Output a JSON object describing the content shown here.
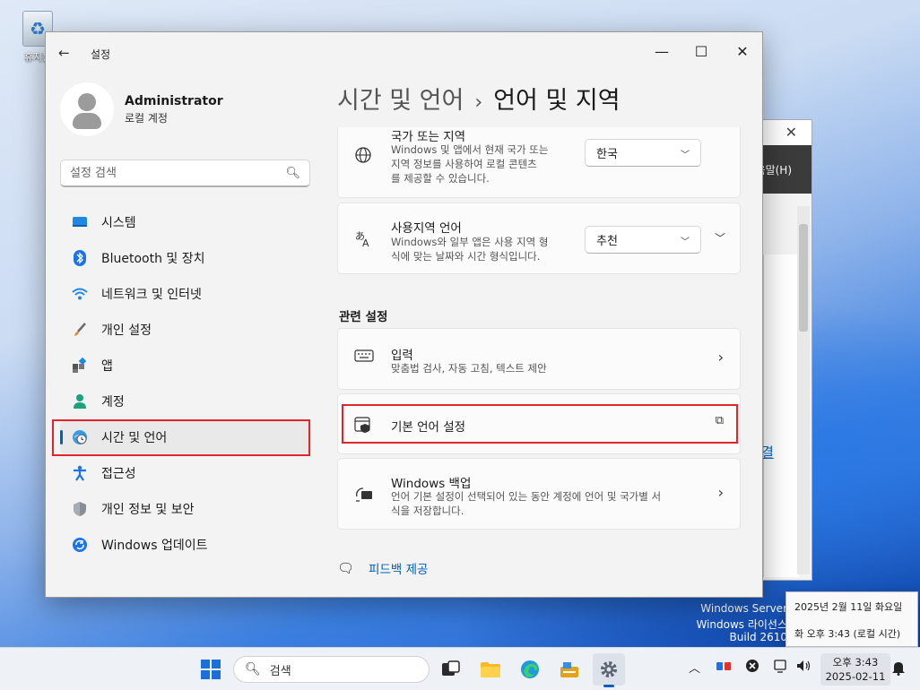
{
  "desktop": {
    "recycle_bin_label": "휴지통",
    "watermark": [
      "Windows Server",
      "Windows 라이선스",
      "Build 2610"
    ]
  },
  "background_window": {
    "menu_text": "움말(H)",
    "link_text": "결"
  },
  "settings": {
    "app_title": "설정",
    "user": {
      "name": "Administrator",
      "account_type": "로컬 계정"
    },
    "search": {
      "placeholder": "설정 검색"
    },
    "nav": [
      {
        "label": "시스템",
        "icon": "monitor-icon"
      },
      {
        "label": "Bluetooth 및 장치",
        "icon": "bluetooth-icon"
      },
      {
        "label": "네트워크 및 인터넷",
        "icon": "wifi-icon"
      },
      {
        "label": "개인 설정",
        "icon": "brush-icon"
      },
      {
        "label": "앱",
        "icon": "apps-icon"
      },
      {
        "label": "계정",
        "icon": "person-icon"
      },
      {
        "label": "시간 및 언어",
        "icon": "globe-clock-icon",
        "active": true
      },
      {
        "label": "접근성",
        "icon": "accessibility-icon"
      },
      {
        "label": "개인 정보 및 보안",
        "icon": "shield-icon"
      },
      {
        "label": "Windows 업데이트",
        "icon": "update-icon"
      }
    ],
    "breadcrumb": {
      "parent": "시간 및 언어",
      "separator": "›",
      "current": "언어 및 지역"
    },
    "region_card": {
      "title": "국가 또는 지역",
      "desc": [
        "Windows 및 앱에서 현재 국가 또는",
        "지역 정보를 사용하여 로컬 콘텐츠",
        "를 제공할 수 있습니다."
      ],
      "value": "한국"
    },
    "format_card": {
      "title": "사용지역 언어",
      "desc": [
        "Windows와 일부 앱은 사용 지역 형",
        "식에 맞는 날짜와 시간 형식입니다."
      ],
      "value": "추천"
    },
    "related_heading": "관련 설정",
    "input_card": {
      "title": "입력",
      "desc": "맞춤법 검사, 자동 고침, 텍스트 제안"
    },
    "admin_lang_card": {
      "title": "기본 언어 설정"
    },
    "backup_card": {
      "title": "Windows 백업",
      "desc": [
        "언어 기본 설정이 선택되어 있는 동안 계정에 언어 및 국가별 서",
        "식을 저장합니다."
      ]
    },
    "feedback": "피드백 제공"
  },
  "tooltip": {
    "line1": "2025년 2월 11일 화요일",
    "line2": "화 오후 3:43 (로컬 시간)"
  },
  "taskbar": {
    "search_label": "검색",
    "time": "오후 3:43",
    "date": "2025-02-11"
  },
  "colors": {
    "accent": "#005fb8",
    "highlight_box": "#e3242b"
  }
}
